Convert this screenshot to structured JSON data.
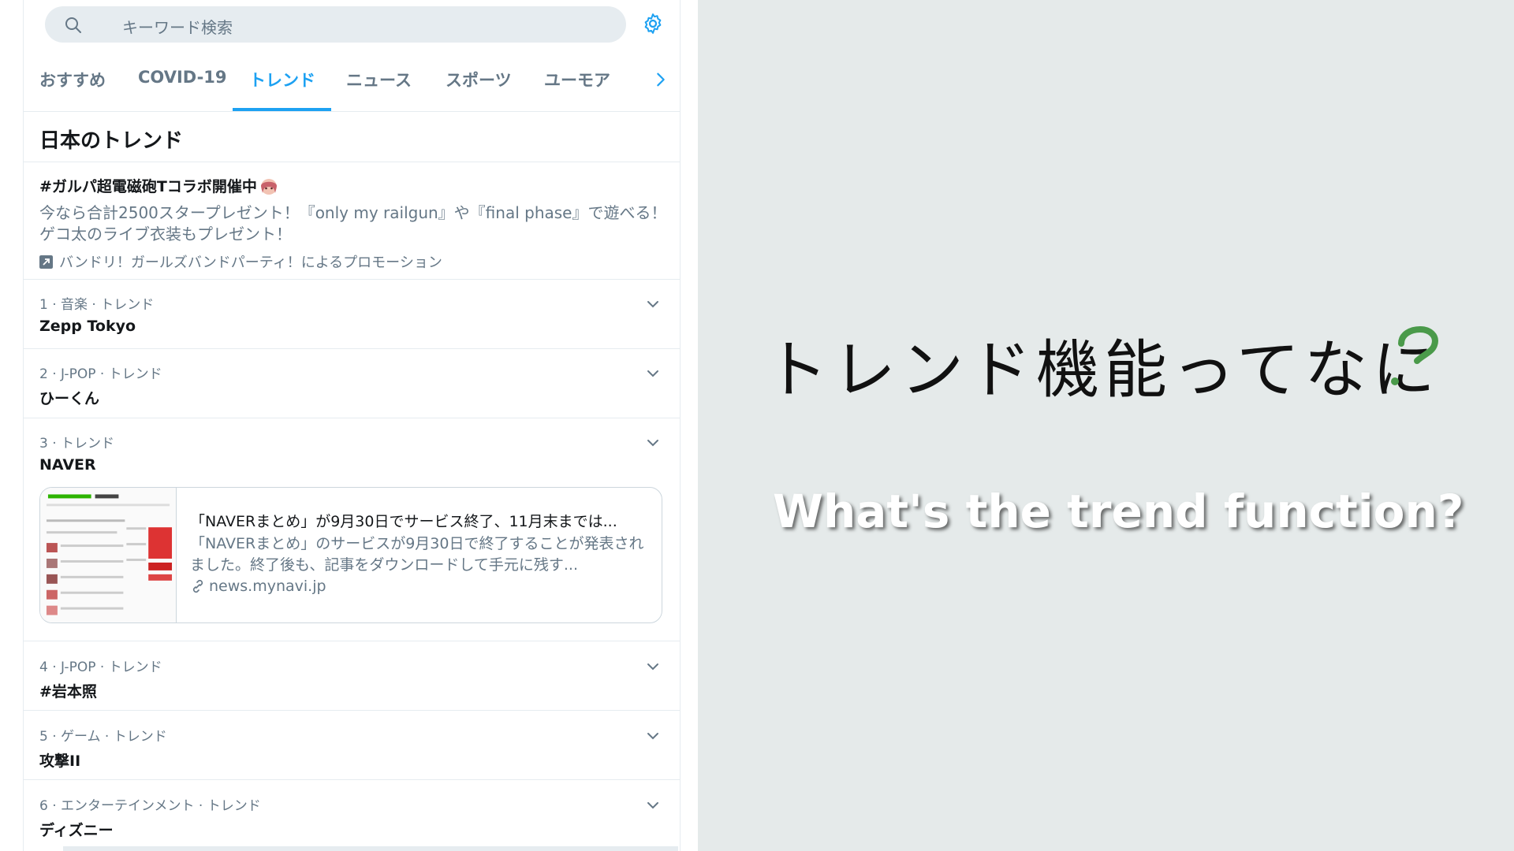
{
  "search": {
    "placeholder": "キーワード検索"
  },
  "tabs": [
    {
      "label": "おすすめ"
    },
    {
      "label": "COVID-19"
    },
    {
      "label": "トレンド"
    },
    {
      "label": "ニュース"
    },
    {
      "label": "スポーツ"
    },
    {
      "label": "ユーモア"
    }
  ],
  "section_title": "日本のトレンド",
  "promoted": {
    "hashtag": "#ガルパ超電磁砲Tコラボ開催中",
    "description_line1": "今なら合計2500スタープレゼント！『only my railgun』や『final phase』で遊べる！",
    "description_line2": "ゲコ太のライブ衣装もプレゼント！",
    "promoted_by": "バンドリ！ガールズバンドパーティ！によるプロモーション"
  },
  "trends": [
    {
      "meta": "1 · 音楽 · トレンド",
      "name": "Zepp Tokyo"
    },
    {
      "meta": "2 · J-POP · トレンド",
      "name": "ひーくん"
    },
    {
      "meta": "3 · トレンド",
      "name": "NAVER"
    },
    {
      "meta": "4 · J-POP · トレンド",
      "name": "#岩本照"
    },
    {
      "meta": "5 · ゲーム · トレンド",
      "name": "攻撃II"
    },
    {
      "meta": "6 · エンターテインメント · トレンド",
      "name": "ディズニー"
    }
  ],
  "news_card": {
    "title": "「NAVERまとめ」が9月30日でサービス終了、11月末までは...",
    "description": "「NAVERまとめ」のサービスが9月30日で終了することが発表されました。終了後も、記事をダウンロードして手元に残す...",
    "domain": "news.mynavi.jp"
  },
  "headline": "トレンド機能ってなに",
  "subheadline": "What's the trend function?",
  "colors": {
    "accent": "#1da1f2",
    "secondary_text": "#657786",
    "background": "#e5eaea",
    "question_mark": "#4a9a4a"
  }
}
